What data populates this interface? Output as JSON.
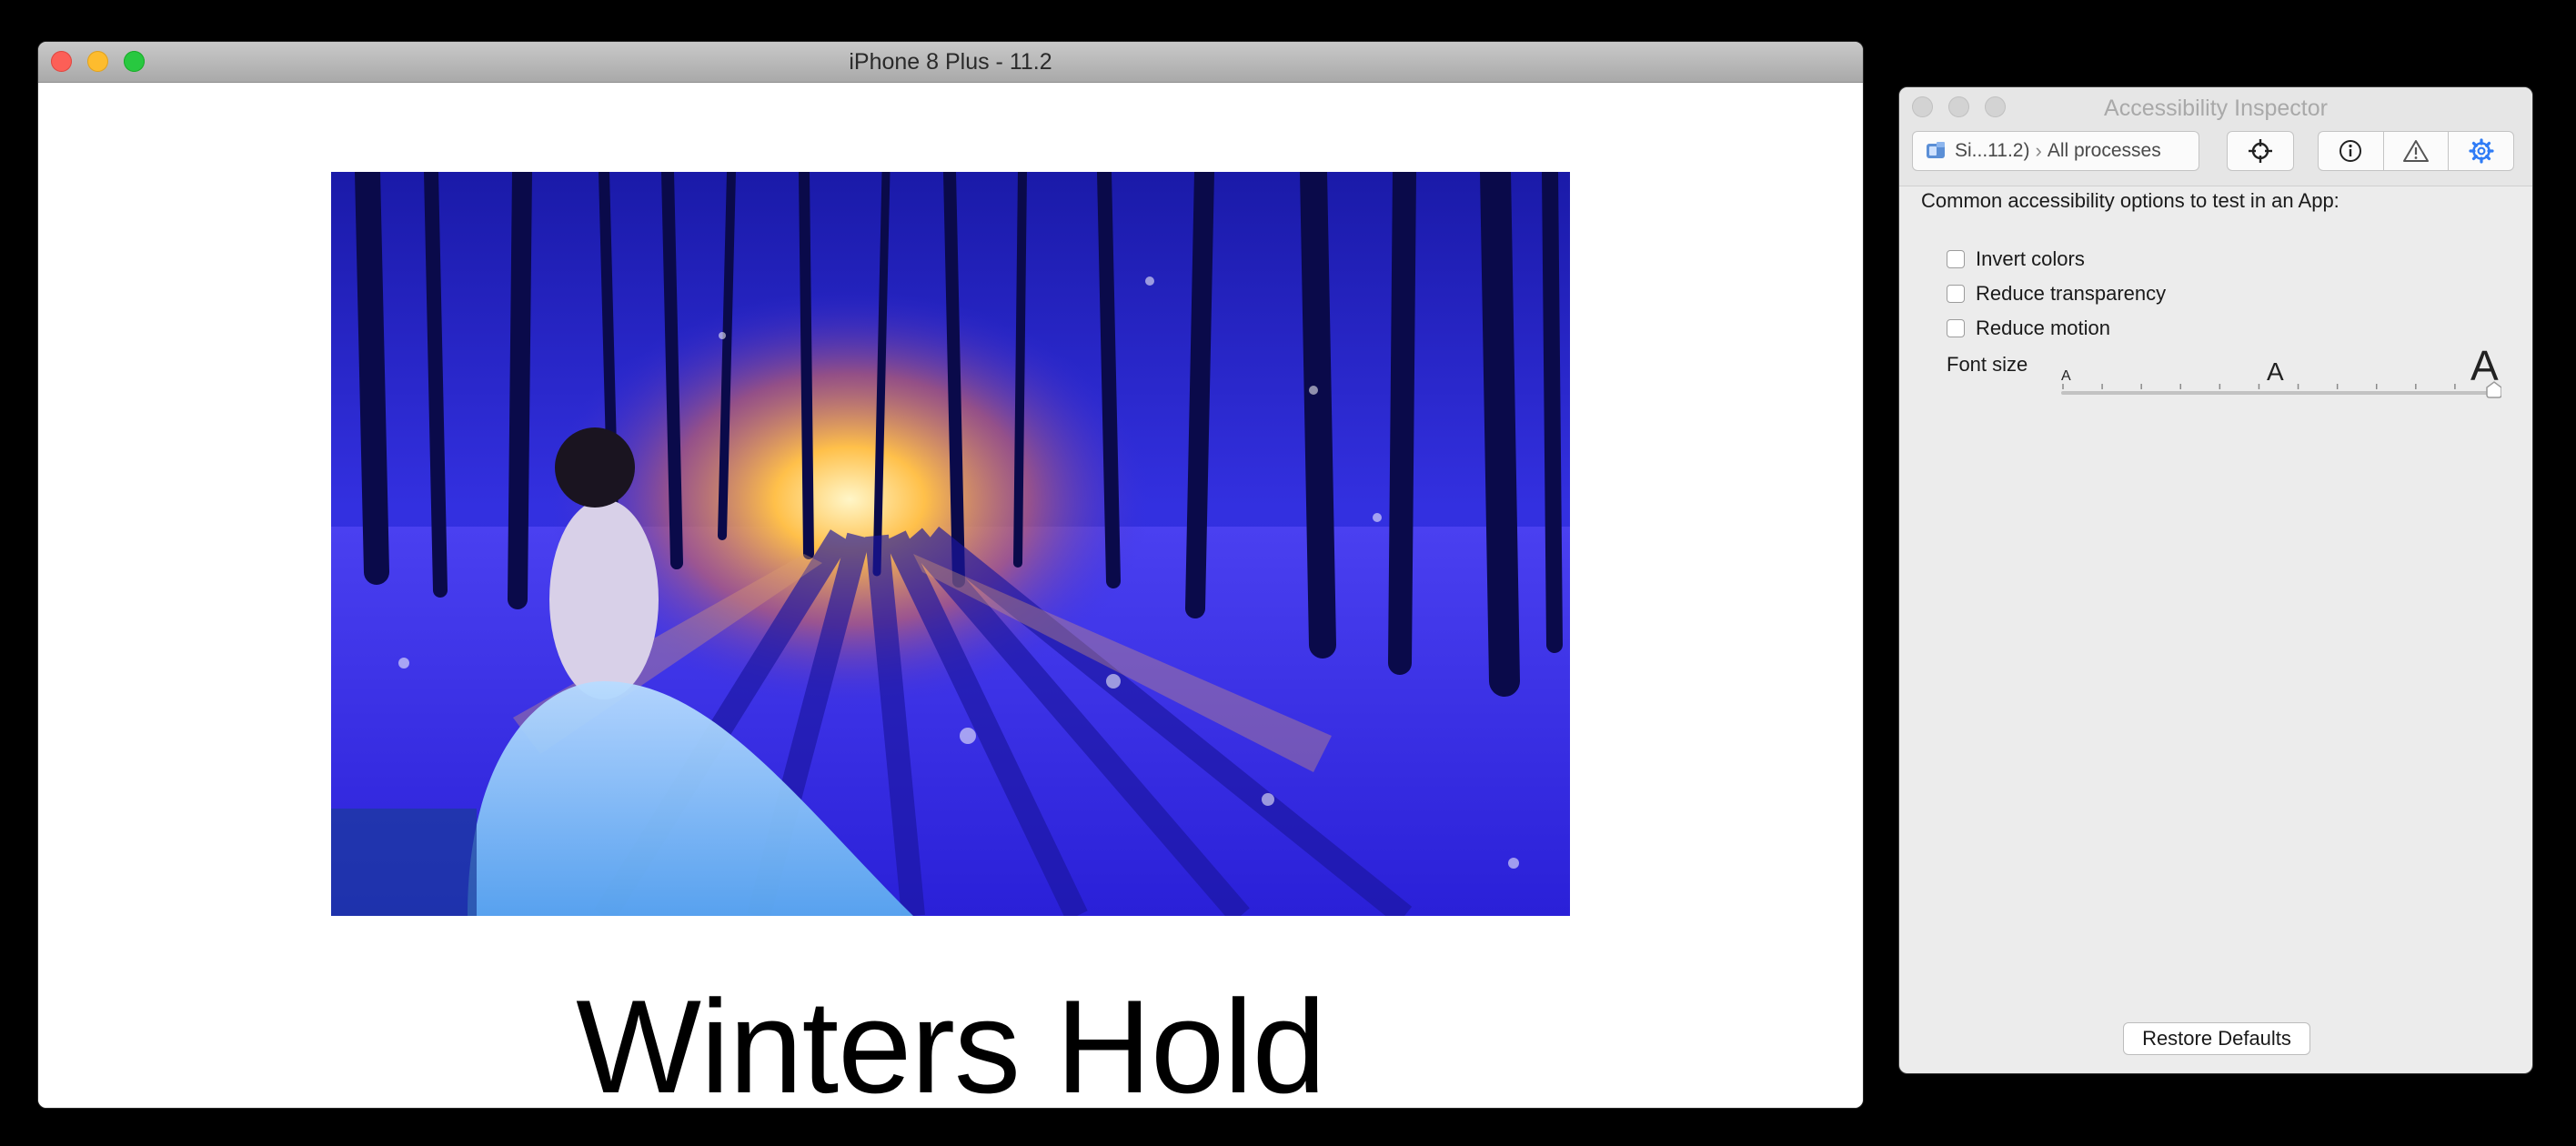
{
  "simulator": {
    "title": "iPhone 8 Plus - 11.2",
    "app_title": "Winters Hold"
  },
  "inspector": {
    "title": "Accessibility Inspector",
    "target_device": "Si...11.2)",
    "target_process": "All processes",
    "heading": "Common accessibility options to test in an App:",
    "options": [
      {
        "label": "Invert colors",
        "checked": false
      },
      {
        "label": "Reduce transparency",
        "checked": false
      },
      {
        "label": "Reduce motion",
        "checked": false
      }
    ],
    "font_size": {
      "label": "Font size",
      "small_glyph": "A",
      "mid_glyph": "A",
      "large_glyph": "A",
      "value_fraction": 1.0
    },
    "restore_label": "Restore Defaults",
    "accent_color": "#2f7cf6"
  },
  "icons": {
    "device": "simulator-device-icon",
    "crosshair": "crosshair-icon",
    "info": "info-icon",
    "warning": "warning-icon",
    "settings": "gear-icon"
  }
}
